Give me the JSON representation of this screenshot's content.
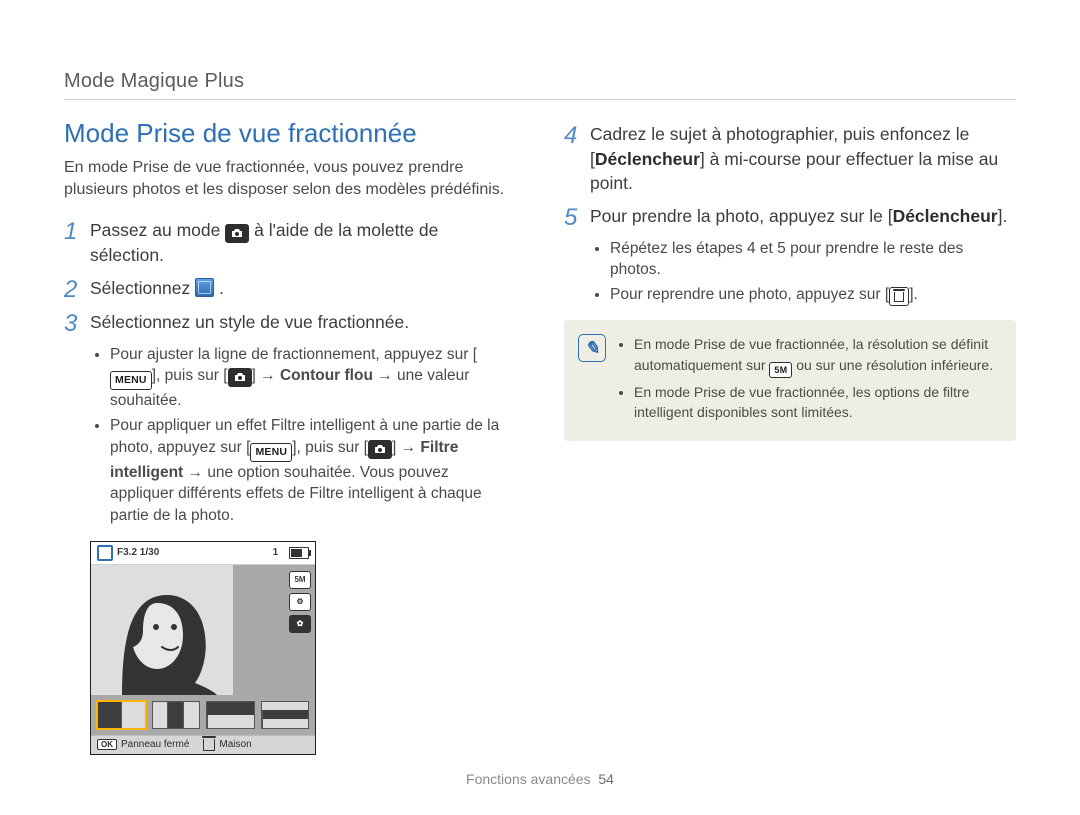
{
  "header": {
    "breadcrumb": "Mode Magique Plus"
  },
  "left": {
    "title": "Mode Prise de vue fractionnée",
    "intro": "En mode Prise de vue fractionnée, vous pouvez prendre plusieurs photos et les disposer selon des modèles prédéfinis.",
    "steps": {
      "s1": {
        "num": "1",
        "pre": "Passez au mode ",
        "post": " à l'aide de la molette de sélection."
      },
      "s2": {
        "num": "2",
        "pre": "Sélectionnez ",
        "post": "."
      },
      "s3": {
        "num": "3",
        "text": "Sélectionnez un style de vue fractionnée."
      }
    },
    "bullets": {
      "b1": {
        "a": "Pour ajuster la ligne de fractionnement, appuyez sur [",
        "menu": "MENU",
        "b": "], puis sur [",
        "c": "] → ",
        "bold1": "Contour flou",
        "d": " → une valeur souhaitée."
      },
      "b2": {
        "a": "Pour appliquer un effet Filtre intelligent à une partie de la photo, appuyez sur [",
        "menu": "MENU",
        "b": "], puis sur [",
        "c": "] → ",
        "bold1": "Filtre intelligent",
        "d": " → une option souhaitée. Vous pouvez appliquer différents effets de Filtre intelligent à chaque partie de la photo."
      }
    },
    "preview": {
      "exposure": "F3.2 1/30",
      "batt_label": "1",
      "res_label": "5M",
      "ok": "OK",
      "ok_label": "Panneau fermé",
      "trash_label": "Maison"
    }
  },
  "right": {
    "steps": {
      "s4": {
        "num": "4",
        "a": "Cadrez le sujet à photographier, puis enfoncez le [",
        "bold": "Déclencheur",
        "b": "] à mi-course pour effectuer la mise au point."
      },
      "s5": {
        "num": "5",
        "a": "Pour prendre la photo, appuyez sur le [",
        "bold": "Déclencheur",
        "b": "]."
      }
    },
    "bullets": {
      "b1": "Répétez les étapes 4 et 5 pour prendre le reste des photos.",
      "b2a": "Pour reprendre une photo, appuyez sur [",
      "b2b": "]."
    },
    "note": {
      "n1a": "En mode Prise de vue fractionnée, la résolution se définit automatiquement sur ",
      "n1_badge": "5M",
      "n1b": " ou sur une résolution inférieure.",
      "n2": "En mode Prise de vue fractionnée, les options de filtre intelligent disponibles sont limitées."
    }
  },
  "footer": {
    "section": "Fonctions avancées",
    "page": "54"
  }
}
